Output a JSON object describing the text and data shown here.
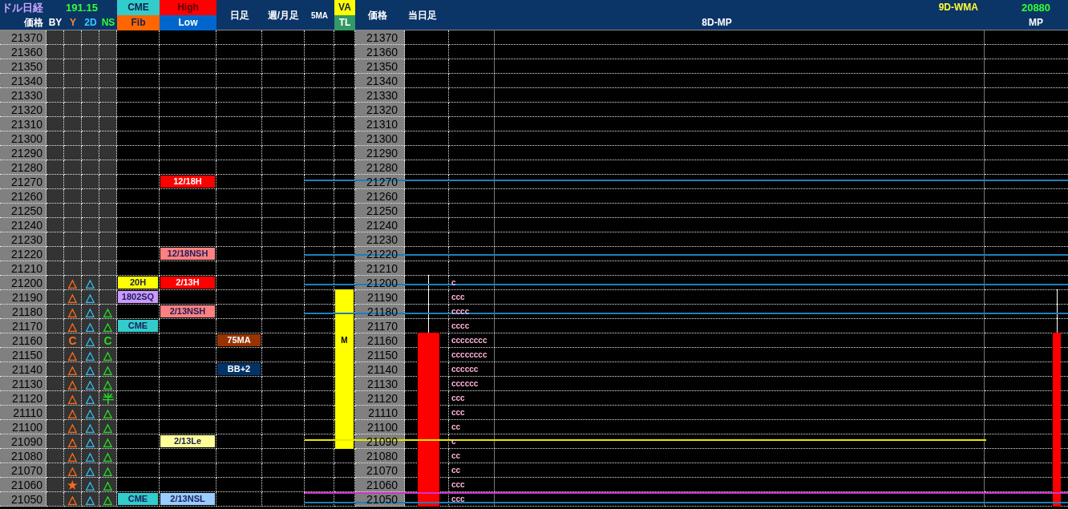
{
  "header": {
    "title": "ドル日経",
    "price_label": "価格",
    "rate": "191.15",
    "by": "BY",
    "y": "Y",
    "d2": "2D",
    "ns": "NS",
    "cme": "CME",
    "fib": "Fib",
    "high": "High",
    "low": "Low",
    "daily": "日足",
    "weekly": "週/月足",
    "ma5": "5MA",
    "va": "VA",
    "tl": "TL",
    "price2": "価格",
    "today": "当日足",
    "wma": "9D-WMA",
    "mp8": "8D-MP",
    "mp_value": "20880",
    "mp": "MP"
  },
  "rows": [
    {
      "price": "21370",
      "price2": "21370",
      "va": false,
      "wick": false,
      "body": false,
      "mp_wick": false,
      "mp_body": false
    },
    {
      "price": "21360",
      "price2": "21360",
      "va": false,
      "wick": false,
      "body": false,
      "mp_wick": false,
      "mp_body": false
    },
    {
      "price": "21350",
      "price2": "21350",
      "va": false,
      "wick": false,
      "body": false,
      "mp_wick": false,
      "mp_body": false
    },
    {
      "price": "21340",
      "price2": "21340",
      "va": false,
      "wick": false,
      "body": false,
      "mp_wick": false,
      "mp_body": false
    },
    {
      "price": "21330",
      "price2": "21330",
      "va": false,
      "wick": false,
      "body": false,
      "mp_wick": false,
      "mp_body": false
    },
    {
      "price": "21320",
      "price2": "21320",
      "va": false,
      "wick": false,
      "body": false,
      "mp_wick": false,
      "mp_body": false
    },
    {
      "price": "21310",
      "price2": "21310",
      "va": false,
      "wick": false,
      "body": false,
      "mp_wick": false,
      "mp_body": false
    },
    {
      "price": "21300",
      "price2": "21300",
      "va": false,
      "wick": false,
      "body": false,
      "mp_wick": false,
      "mp_body": false
    },
    {
      "price": "21290",
      "price2": "21290",
      "va": false,
      "wick": false,
      "body": false,
      "mp_wick": false,
      "mp_body": false
    },
    {
      "price": "21280",
      "price2": "21280",
      "va": false,
      "wick": false,
      "body": false,
      "mp_wick": false,
      "mp_body": false
    },
    {
      "price": "21270",
      "price2": "21270",
      "hl": {
        "text": "12/18H",
        "color": "#ff0000"
      },
      "va": false,
      "wick": false,
      "body": false,
      "mp_wick": false,
      "mp_body": false
    },
    {
      "price": "21260",
      "price2": "21260",
      "va": false,
      "wick": false,
      "body": false,
      "mp_wick": false,
      "mp_body": false
    },
    {
      "price": "21250",
      "price2": "21250",
      "va": false,
      "wick": false,
      "body": false,
      "mp_wick": false,
      "mp_body": false
    },
    {
      "price": "21240",
      "price2": "21240",
      "va": false,
      "wick": false,
      "body": false,
      "mp_wick": false,
      "mp_body": false
    },
    {
      "price": "21230",
      "price2": "21230",
      "va": false,
      "wick": false,
      "body": false,
      "mp_wick": false,
      "mp_body": false
    },
    {
      "price": "21220",
      "price2": "21220",
      "hl": {
        "text": "12/18NSH",
        "color": "#ff8080"
      },
      "va": false,
      "wick": false,
      "body": false,
      "mp_wick": false,
      "mp_body": false
    },
    {
      "price": "21210",
      "price2": "21210",
      "va": false,
      "wick": false,
      "body": false,
      "mp_wick": false,
      "mp_body": false
    },
    {
      "price": "21200",
      "price2": "21200",
      "y": "△",
      "d2": "△",
      "cme": {
        "text": "20H",
        "color": "#ffff00"
      },
      "hl": {
        "text": "2/13H",
        "color": "#ff0000"
      },
      "va": false,
      "wick": true,
      "body": false,
      "mp_wick": false,
      "mp_body": false,
      "tpo": "c"
    },
    {
      "price": "21190",
      "price2": "21190",
      "y": "△",
      "d2": "△",
      "cme": {
        "text": "1802SQ",
        "color": "#cc99ff"
      },
      "va": true,
      "wick": true,
      "body": false,
      "mp_wick": true,
      "mp_body": false,
      "tpo": "ccc"
    },
    {
      "price": "21180",
      "price2": "21180",
      "y": "△",
      "d2": "△",
      "ns": "△",
      "hl": {
        "text": "2/13NSH",
        "color": "#ff8080"
      },
      "va": true,
      "wick": true,
      "body": false,
      "mp_wick": true,
      "mp_body": false,
      "tpo": "cccc"
    },
    {
      "price": "21170",
      "price2": "21170",
      "y": "△",
      "d2": "△",
      "ns": "△",
      "cme": {
        "text": "CME",
        "color": "#33cccc"
      },
      "va": true,
      "wick": true,
      "body": false,
      "mp_wick": true,
      "mp_body": false,
      "tpo": "cccc"
    },
    {
      "price": "21160",
      "price2": "21160",
      "y": "C",
      "d2": "△",
      "ns": "C",
      "daily": {
        "text": "75MA",
        "color": "#993300"
      },
      "va": true,
      "va_text": "M",
      "wick": false,
      "body": true,
      "mp_wick": false,
      "mp_body": true,
      "tpo": "cccccccc"
    },
    {
      "price": "21150",
      "price2": "21150",
      "y": "△",
      "d2": "△",
      "ns": "△",
      "va": true,
      "wick": false,
      "body": true,
      "mp_wick": false,
      "mp_body": true,
      "tpo": "cccccccc"
    },
    {
      "price": "21140",
      "price2": "21140",
      "y": "△",
      "d2": "△",
      "ns": "△",
      "daily": {
        "text": "BB+2",
        "color": "#003366"
      },
      "va": true,
      "wick": false,
      "body": true,
      "mp_wick": false,
      "mp_body": true,
      "tpo": "cccccc"
    },
    {
      "price": "21130",
      "price2": "21130",
      "y": "△",
      "d2": "△",
      "ns": "△",
      "va": true,
      "wick": false,
      "body": true,
      "mp_wick": false,
      "mp_body": true,
      "tpo": "cccccc"
    },
    {
      "price": "21120",
      "price2": "21120",
      "y": "△",
      "d2": "△",
      "ns": "半",
      "va": true,
      "wick": false,
      "body": true,
      "mp_wick": false,
      "mp_body": true,
      "tpo": "ccc"
    },
    {
      "price": "21110",
      "price2": "21110",
      "y": "△",
      "d2": "△",
      "ns": "△",
      "va": true,
      "wick": false,
      "body": true,
      "mp_wick": false,
      "mp_body": true,
      "tpo": "ccc"
    },
    {
      "price": "21100",
      "price2": "21100",
      "y": "△",
      "d2": "△",
      "ns": "△",
      "va": true,
      "wick": false,
      "body": true,
      "mp_wick": false,
      "mp_body": true,
      "tpo": "cc"
    },
    {
      "price": "21090",
      "price2": "21090",
      "y": "△",
      "d2": "△",
      "ns": "△",
      "hl": {
        "text": "2/13Le",
        "color": "#ffff99"
      },
      "va": true,
      "wick": false,
      "body": true,
      "mp_wick": false,
      "mp_body": true,
      "tpo": "c"
    },
    {
      "price": "21080",
      "price2": "21080",
      "y": "△",
      "d2": "△",
      "ns": "△",
      "va": false,
      "wick": false,
      "body": true,
      "mp_wick": false,
      "mp_body": true,
      "tpo": "cc"
    },
    {
      "price": "21070",
      "price2": "21070",
      "y": "△",
      "d2": "△",
      "ns": "△",
      "va": false,
      "wick": false,
      "body": true,
      "mp_wick": false,
      "mp_body": true,
      "tpo": "cc"
    },
    {
      "price": "21060",
      "price2": "21060",
      "y": "★",
      "d2": "△",
      "ns": "△",
      "va": false,
      "wick": false,
      "body": true,
      "mp_wick": false,
      "mp_body": true,
      "tpo": "ccc"
    },
    {
      "price": "21050",
      "price2": "21050",
      "y": "△",
      "d2": "△",
      "ns": "△",
      "cme": {
        "text": "CME",
        "color": "#33cccc"
      },
      "hl": {
        "text": "2/13NSL",
        "color": "#99ccff"
      },
      "va": false,
      "wick": false,
      "body": true,
      "mp_wick": false,
      "mp_body": true,
      "tpo": "ccc"
    }
  ]
}
